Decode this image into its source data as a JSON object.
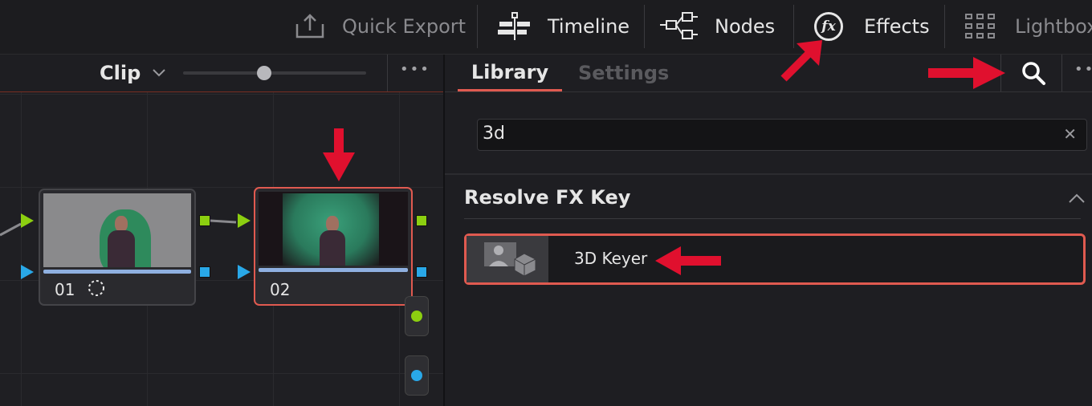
{
  "topbar": {
    "quick_export": "Quick Export",
    "timeline": "Timeline",
    "nodes": "Nodes",
    "effects": "Effects",
    "lightbox": "Lightbox",
    "effects_icon_text": "fx"
  },
  "left": {
    "clip_label": "Clip",
    "more": "•••",
    "nodes": [
      {
        "number": "01"
      },
      {
        "number": "02"
      }
    ]
  },
  "right": {
    "tabs": [
      "Library",
      "Settings"
    ],
    "search_value": "3d",
    "clear": "✕",
    "more": "••",
    "section_title": "Resolve FX Key",
    "item_label": "3D Keyer"
  },
  "colors": {
    "accent_red": "#e05a50",
    "arrow_red": "#e0102e",
    "port_green": "#8ccf10",
    "port_blue": "#29a8e8"
  }
}
